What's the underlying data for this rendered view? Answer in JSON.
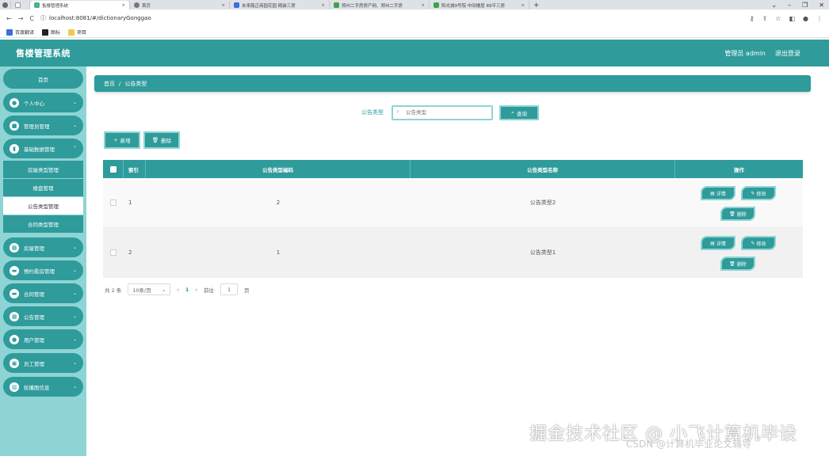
{
  "browser": {
    "tabs": [
      {
        "label": "",
        "icon": "chrome-icon"
      },
      {
        "label": "",
        "icon": "blank-tab-icon"
      },
      {
        "label": "售楼管理系统",
        "icon": "vue-icon",
        "active": true
      },
      {
        "label": "首页",
        "icon": "chrome-icon"
      },
      {
        "label": "未来路正商园花园 精装三房",
        "icon": "blue-icon"
      },
      {
        "label": "郑州二手房房产网、郑州二手房",
        "icon": "green-icon"
      },
      {
        "label": "阳光城9号院 中间楼层 89平三房",
        "icon": "green-icon"
      }
    ],
    "new_tab": "+",
    "url": "localhost:8081/#/dictionaryGonggao",
    "bookmarks": [
      "百度翻译",
      "图标",
      "项目"
    ]
  },
  "header": {
    "app_title": "售楼管理系统",
    "admin_label": "管理员 admin",
    "logout": "退出登录"
  },
  "sidebar": {
    "home": "首页",
    "personal": "个人中心",
    "admin_mgmt": "管理员管理",
    "basic_data": "基础数据管理",
    "sub": [
      "房屋类型管理",
      "楼盘管理",
      "公告类型管理",
      "合同类型管理"
    ],
    "house": "房屋管理",
    "appointment": "预约看房管理",
    "contract": "合同管理",
    "notice": "公告管理",
    "user": "用户管理",
    "employee": "员工管理",
    "carousel": "轮播图信息"
  },
  "breadcrumb": {
    "home": "首页",
    "sep": "/",
    "current": "公告类型"
  },
  "search": {
    "label": "公告类型",
    "placeholder": "公告类型",
    "button": "查询"
  },
  "actions": {
    "add": "新增",
    "delete": "删除"
  },
  "table": {
    "headers": {
      "index": "索引",
      "code": "公告类型编码",
      "name": "公告类型名称",
      "op": "操作"
    },
    "rows": [
      {
        "index": "1",
        "code": "2",
        "name": "公告类型2"
      },
      {
        "index": "2",
        "code": "1",
        "name": "公告类型1"
      }
    ],
    "ops": {
      "detail": "详情",
      "edit": "修改",
      "delete": "删除"
    }
  },
  "pager": {
    "total": "共 2 条",
    "pagesize": "10条/页",
    "prev": "‹",
    "page": "1",
    "next": "›",
    "goto": "前往",
    "goto_value": "1",
    "page_unit": "页"
  },
  "watermark": {
    "line1": "掘金技术社区 @ 小飞计算机毕设",
    "line2": "CSDN @计算机毕业论文辅导"
  },
  "colors": {
    "primary": "#2f9b9b",
    "sidebar_bg": "#8fd4d4",
    "border_light": "#8fd4d4"
  }
}
